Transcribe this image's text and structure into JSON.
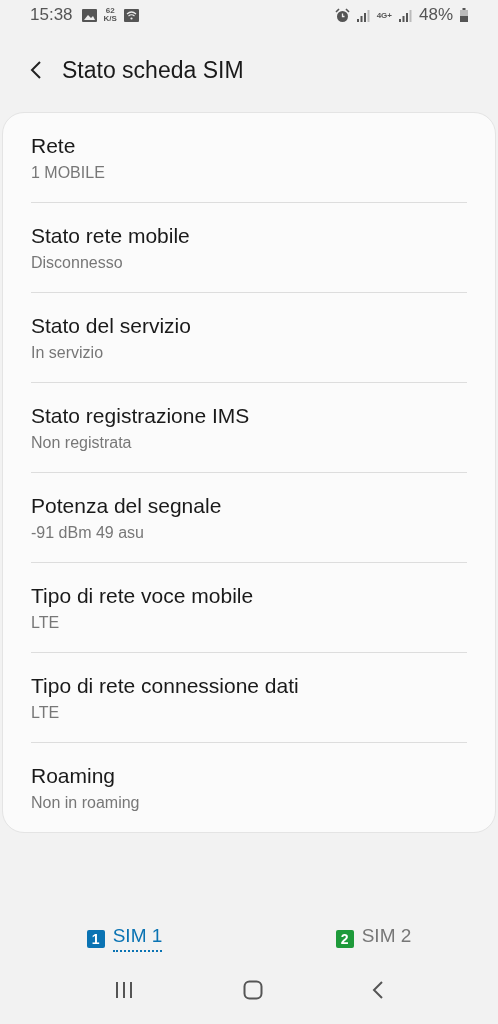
{
  "status_bar": {
    "time": "15:38",
    "net_speed": "62",
    "net_unit": "K/S",
    "network_type": "4G+",
    "battery": "48%"
  },
  "header": {
    "title": "Stato scheda SIM"
  },
  "items": [
    {
      "title": "Rete",
      "value": "1 MOBILE"
    },
    {
      "title": "Stato rete mobile",
      "value": "Disconnesso"
    },
    {
      "title": "Stato del servizio",
      "value": "In servizio"
    },
    {
      "title": "Stato registrazione IMS",
      "value": "Non registrata"
    },
    {
      "title": "Potenza del segnale",
      "value": "-91 dBm 49 asu"
    },
    {
      "title": "Tipo di rete voce mobile",
      "value": "LTE"
    },
    {
      "title": "Tipo di rete connessione dati",
      "value": "LTE"
    },
    {
      "title": "Roaming",
      "value": "Non in roaming"
    }
  ],
  "sim_tabs": [
    {
      "number": "1",
      "label": "SIM 1",
      "color": "#0a73b3",
      "selected": true
    },
    {
      "number": "2",
      "label": "SIM 2",
      "color": "#1e9a3a",
      "selected": false
    }
  ]
}
